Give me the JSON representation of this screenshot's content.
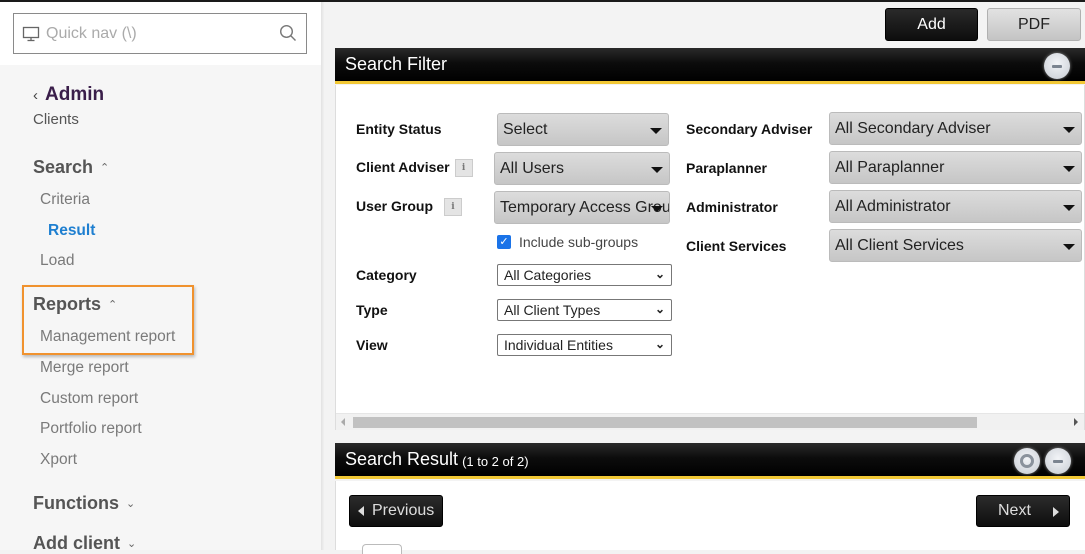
{
  "sidebar": {
    "quick_nav_placeholder": "Quick nav (\\)",
    "back_title": "Admin",
    "subtitle": "Clients",
    "sections": [
      {
        "label": "Search",
        "expanded": true,
        "items": [
          {
            "label": "Criteria",
            "active": false
          },
          {
            "label": "Result",
            "active": true
          },
          {
            "label": "Load",
            "active": false
          }
        ]
      },
      {
        "label": "Reports",
        "expanded": true,
        "highlighted": true,
        "items": [
          {
            "label": "Management report"
          },
          {
            "label": "Merge report"
          },
          {
            "label": "Custom report"
          },
          {
            "label": "Portfolio report"
          },
          {
            "label": "Xport"
          }
        ]
      },
      {
        "label": "Functions",
        "expanded": false
      },
      {
        "label": "Add client",
        "expanded": false
      }
    ]
  },
  "toolbar": {
    "add_label": "Add",
    "pdf_label": "PDF"
  },
  "search_filter": {
    "title": "Search Filter",
    "left": {
      "entity_status": {
        "label": "Entity Status",
        "value": "Select"
      },
      "client_adviser": {
        "label": "Client Adviser",
        "value": "All Users",
        "info": "i"
      },
      "user_group": {
        "label": "User Group",
        "value": "Temporary Access Group",
        "info": "i"
      },
      "include_subgroups": {
        "label": "Include sub-groups",
        "checked": true
      },
      "category": {
        "label": "Category",
        "value": "All Categories"
      },
      "type": {
        "label": "Type",
        "value": "All Client Types"
      },
      "view": {
        "label": "View",
        "value": "Individual Entities"
      }
    },
    "right": {
      "secondary_adviser": {
        "label": "Secondary Adviser",
        "value": "All Secondary Adviser"
      },
      "paraplanner": {
        "label": "Paraplanner",
        "value": "All Paraplanner"
      },
      "administrator": {
        "label": "Administrator",
        "value": "All Administrator"
      },
      "client_services": {
        "label": "Client Services",
        "value": "All Client Services"
      }
    }
  },
  "search_result": {
    "title": "Search Result",
    "count": "(1 to 2 of 2)",
    "previous_label": "Previous",
    "next_label": "Next"
  },
  "colors": {
    "accent_yellow": "#f2c835",
    "highlight_orange": "#f0922e",
    "active_link": "#1e7fd0",
    "admin_title": "#3a1e4a"
  }
}
